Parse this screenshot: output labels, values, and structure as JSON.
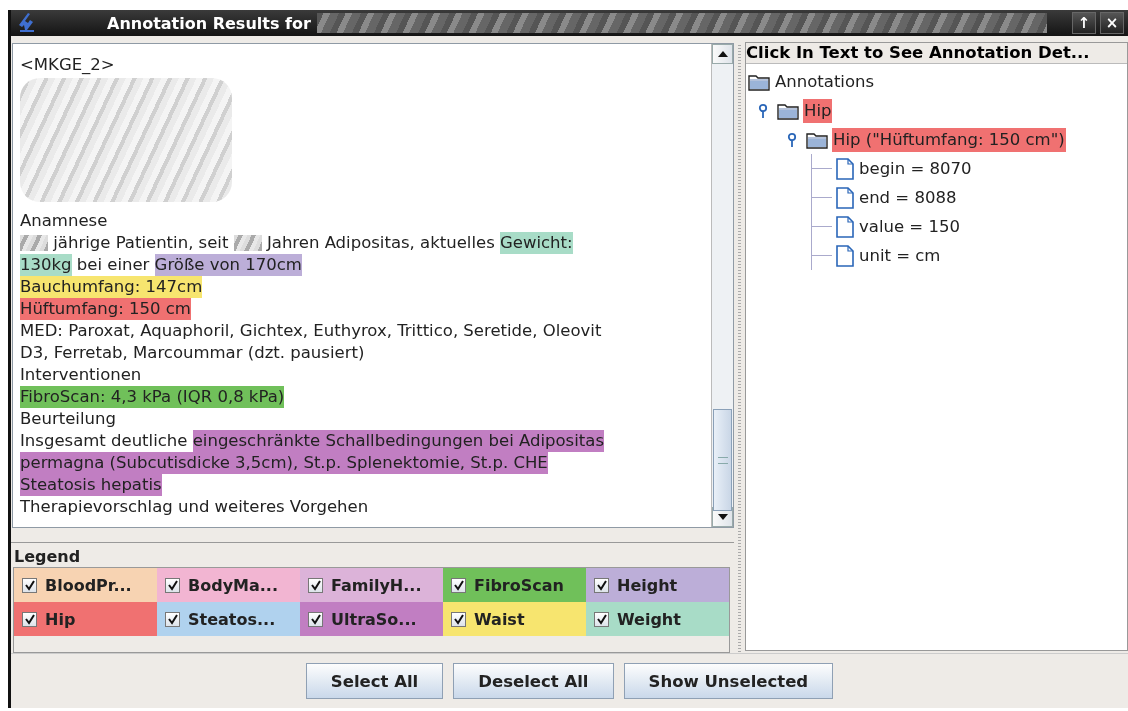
{
  "window": {
    "title": "Annotation Results for",
    "title_redacted": true,
    "controls": [
      "↑",
      "×"
    ]
  },
  "document": {
    "lines": [
      {
        "segments": [
          {
            "text": "<MKGE_2>"
          }
        ]
      },
      {
        "segments": [
          {
            "kind": "redacted_block"
          }
        ]
      },
      {
        "segments": [
          {
            "text": "Anamnese"
          }
        ]
      },
      {
        "segments": [
          {
            "kind": "redacted"
          },
          {
            "text": " jährige Patientin, seit "
          },
          {
            "kind": "redacted"
          },
          {
            "text": " Jahren Adipositas, aktuelles "
          },
          {
            "text": "Gewicht:",
            "color": "#a8dcc7"
          }
        ]
      },
      {
        "segments": [
          {
            "text": "130kg",
            "color": "#a8dcc7"
          },
          {
            "text": " bei einer "
          },
          {
            "text": "Größe von 170cm",
            "color": "#bcaed8"
          }
        ]
      },
      {
        "segments": [
          {
            "text": "Bauchumfang: 147cm",
            "color": "#f7e56f"
          }
        ]
      },
      {
        "segments": [
          {
            "text": "Hüftumfang: 150 cm",
            "color": "#f07171"
          }
        ]
      },
      {
        "segments": [
          {
            "text": "MED: Paroxat, Aquaphoril, Gichtex, Euthyrox, Trittico, Seretide, Oleovit"
          }
        ]
      },
      {
        "segments": [
          {
            "text": "D3, Ferretab, Marcoummar (dzt. pausiert)"
          }
        ]
      },
      {
        "segments": [
          {
            "text": "Interventionen"
          }
        ]
      },
      {
        "segments": [
          {
            "text": "FibroScan: 4,3 kPa (IQR 0,8 kPa)",
            "color": "#70c05a"
          }
        ]
      },
      {
        "segments": [
          {
            "text": "Beurteilung"
          }
        ]
      },
      {
        "segments": [
          {
            "text": "Insgesamt deutliche "
          },
          {
            "text": "eingeschränkte Schallbedingungen bei Adipositas",
            "color": "#c17ec2"
          }
        ]
      },
      {
        "segments": [
          {
            "text": "permagna (Subcutisdicke 3,5cm), St.p. Splenektomie, St.p. CHE",
            "color": "#c17ec2"
          }
        ]
      },
      {
        "segments": [
          {
            "text": "Steatosis hepatis",
            "color": "#c17ec2"
          }
        ]
      },
      {
        "segments": [
          {
            "text": "Therapievorschlag und weiteres Vorgehen"
          }
        ]
      }
    ]
  },
  "details": {
    "header": "Click In Text to See Annotation Det...",
    "tree": [
      {
        "label": "Annotations",
        "kind": "folder",
        "expanded": true,
        "children": [
          {
            "label": "Hip",
            "kind": "folder",
            "expanded": true,
            "color": "#f07171",
            "children": [
              {
                "label": "Hip (\"Hüftumfang: 150 cm\")",
                "kind": "folder",
                "expanded": true,
                "color": "#f07171",
                "children": [
                  {
                    "label": "begin = 8070",
                    "kind": "leaf"
                  },
                  {
                    "label": "end = 8088",
                    "kind": "leaf"
                  },
                  {
                    "label": "value = 150",
                    "kind": "leaf"
                  },
                  {
                    "label": "unit = cm",
                    "kind": "leaf"
                  }
                ]
              }
            ]
          }
        ]
      }
    ]
  },
  "legend": {
    "title": "Legend",
    "items": [
      {
        "label": "BloodPr...",
        "color": "#f7d3b2",
        "checked": true
      },
      {
        "label": "BodyMa...",
        "color": "#f2b5d2",
        "checked": true
      },
      {
        "label": "FamilyH...",
        "color": "#dcb3d9",
        "checked": true
      },
      {
        "label": "FibroScan",
        "color": "#70c05a",
        "checked": true
      },
      {
        "label": "Height",
        "color": "#bcaed8",
        "checked": true
      },
      {
        "label": "Hip",
        "color": "#f07171",
        "checked": true
      },
      {
        "label": "Steatos...",
        "color": "#b0d2ee",
        "checked": true
      },
      {
        "label": "UltraSo...",
        "color": "#c17ec2",
        "checked": true
      },
      {
        "label": "Waist",
        "color": "#f7e56f",
        "checked": true
      },
      {
        "label": "Weight",
        "color": "#a8dcc7",
        "checked": true
      }
    ]
  },
  "buttons": [
    "Select All",
    "Deselect All",
    "Show Unselected"
  ]
}
